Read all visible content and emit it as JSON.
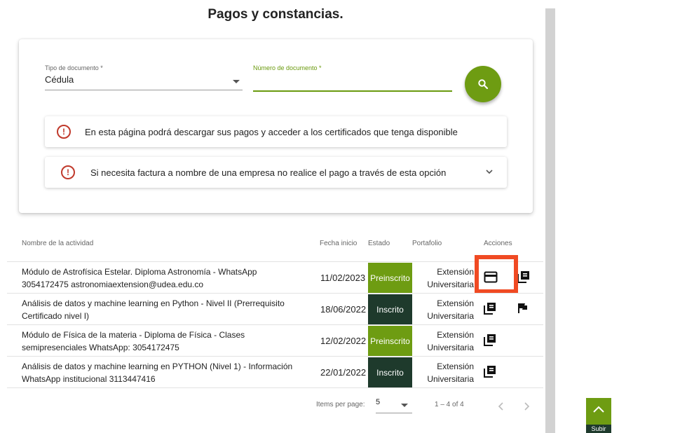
{
  "page": {
    "title": "Pagos y constancias."
  },
  "form": {
    "tipo_label": "Tipo de documento *",
    "tipo_value": "Cédula",
    "numero_label": "Número de documento *",
    "numero_value": ""
  },
  "notices": [
    {
      "text": "En esta página podrá descargar sus pagos y acceder a los certificados que tenga disponible"
    },
    {
      "text": "Si necesita factura a nombre de una empresa no realice el pago a través de esta opción"
    }
  ],
  "table": {
    "headers": {
      "actividad": "Nombre de la actividad",
      "fecha": "Fecha inicio",
      "estado": "Estado",
      "portafolio": "Portafolio",
      "acciones": "Acciones"
    },
    "rows": [
      {
        "line1": "Módulo de Astrofísica Estelar. Diploma Astronomía - WhatsApp",
        "line2": "3054172475 astronomiaextension@udea.edu.co",
        "fecha": "11/02/2023",
        "estado": "Preinscrito",
        "port1": "Extensión",
        "port2": "Universitaria",
        "actions": [
          "credit-card-icon",
          "library-books-icon"
        ]
      },
      {
        "line1": "Análisis de datos y machine learning en Python - Nivel II (Prerrequisito",
        "line2": "Certificado nivel I)",
        "fecha": "18/06/2022",
        "estado": "Inscrito",
        "port1": "Extensión",
        "port2": "Universitaria",
        "actions": [
          "library-books-icon",
          "flag-icon"
        ]
      },
      {
        "line1": "Módulo de Física de la materia - Diploma de Física - Clases",
        "line2": "semipresenciales WhatsApp: 3054172475",
        "fecha": "12/02/2022",
        "estado": "Preinscrito",
        "port1": "Extensión",
        "port2": "Universitaria",
        "actions": [
          "library-books-icon"
        ]
      },
      {
        "line1": "Análisis de datos y machine learning en PYTHON (Nivel 1) - Información",
        "line2": "WhatsApp institucional 3113447416",
        "fecha": "22/01/2022",
        "estado": "Inscrito",
        "port1": "Extensión",
        "port2": "Universitaria",
        "actions": [
          "library-books-icon"
        ]
      }
    ]
  },
  "paginator": {
    "items_label": "Items per page:",
    "page_size": "5",
    "range": "1 – 4 of 4"
  },
  "scroll_top": {
    "label": "Subir"
  },
  "colors": {
    "primary_green": "#6e9c12",
    "dark_green": "#1e3a2c",
    "error_red": "#c0392b",
    "highlight": "#f04a23"
  }
}
